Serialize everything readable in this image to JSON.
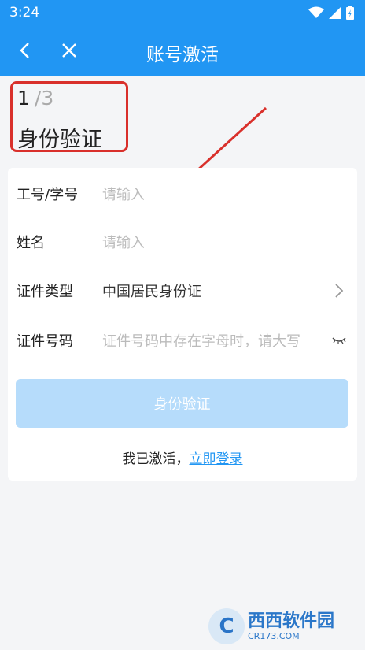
{
  "status_bar": {
    "time": "3:24"
  },
  "app_bar": {
    "title": "账号激活"
  },
  "step": {
    "current": "1",
    "total": "/3",
    "title": "身份验证"
  },
  "form": {
    "rows": [
      {
        "label": "工号/学号",
        "placeholder": "请输入",
        "value": ""
      },
      {
        "label": "姓名",
        "placeholder": "请输入",
        "value": ""
      },
      {
        "label": "证件类型",
        "value": "中国居民身份证"
      },
      {
        "label": "证件号码",
        "placeholder": "证件号码中存在字母时，请大写"
      }
    ],
    "submit_label": "身份验证",
    "activated_text": "我已激活，",
    "login_link": "立即登录"
  },
  "watermark": {
    "main": "西西软件园",
    "sub": "CR173.COM"
  },
  "colors": {
    "primary": "#2196f3",
    "button_disabled": "#b6dcfb",
    "highlight_red": "#d9302b"
  }
}
